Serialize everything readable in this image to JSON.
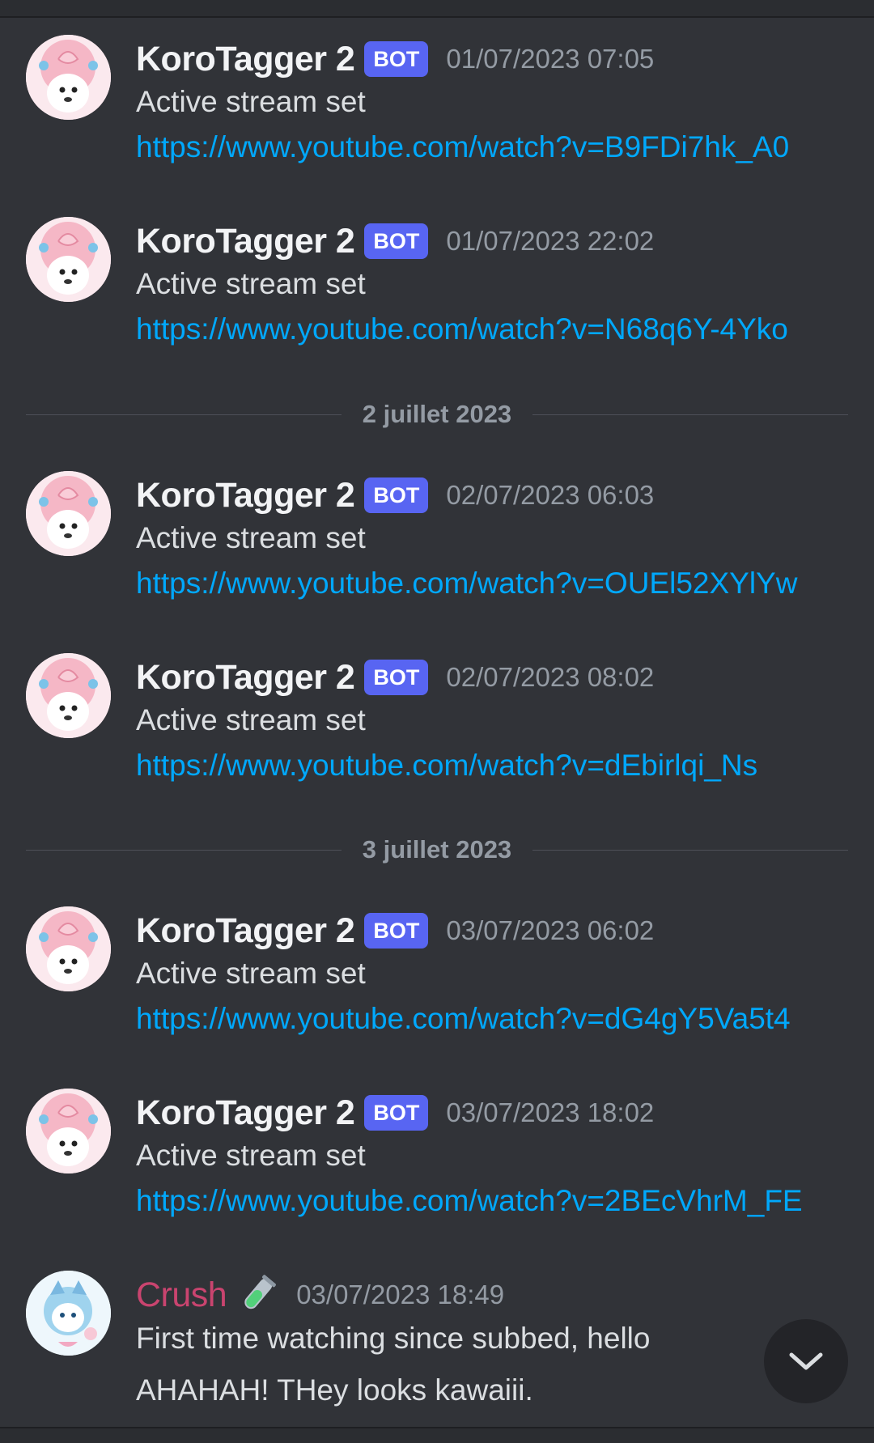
{
  "dividers": [
    {
      "label": "2 juillet 2023"
    },
    {
      "label": "3 juillet 2023"
    }
  ],
  "messages": [
    {
      "author": "KoroTagger 2",
      "tag": "BOT",
      "timestamp": "01/07/2023 07:05",
      "text": "Active stream set",
      "link": "https://www.youtube.com/watch?v=B9FDi7hk_A0"
    },
    {
      "author": "KoroTagger 2",
      "tag": "BOT",
      "timestamp": "01/07/2023 22:02",
      "text": "Active stream set",
      "link": "https://www.youtube.com/watch?v=N68q6Y-4Yko"
    },
    {
      "author": "KoroTagger 2",
      "tag": "BOT",
      "timestamp": "02/07/2023 06:03",
      "text": "Active stream set",
      "link": "https://www.youtube.com/watch?v=OUEl52XYlYw"
    },
    {
      "author": "KoroTagger 2",
      "tag": "BOT",
      "timestamp": "02/07/2023 08:02",
      "text": "Active stream set",
      "link": "https://www.youtube.com/watch?v=dEbirlqi_Ns"
    },
    {
      "author": "KoroTagger 2",
      "tag": "BOT",
      "timestamp": "03/07/2023 06:02",
      "text": "Active stream set",
      "link": "https://www.youtube.com/watch?v=dG4gY5Va5t4"
    },
    {
      "author": "KoroTagger 2",
      "tag": "BOT",
      "timestamp": "03/07/2023 18:02",
      "text": "Active stream set",
      "link": "https://www.youtube.com/watch?v=2BEcVhrM_FE"
    },
    {
      "author": "Crush",
      "author_color": "#c9446f",
      "role_icon": "test-tube-icon",
      "timestamp": "03/07/2023 18:49",
      "text": "First time watching since subbed, hello AHAHAH! THey looks kawaiii."
    }
  ],
  "scroll_button": {
    "icon": "chevron-down-icon"
  },
  "colors": {
    "background": "#313338",
    "link": "#00a8fc",
    "bot_tag": "#5865f2",
    "timestamp": "#949ba4"
  }
}
